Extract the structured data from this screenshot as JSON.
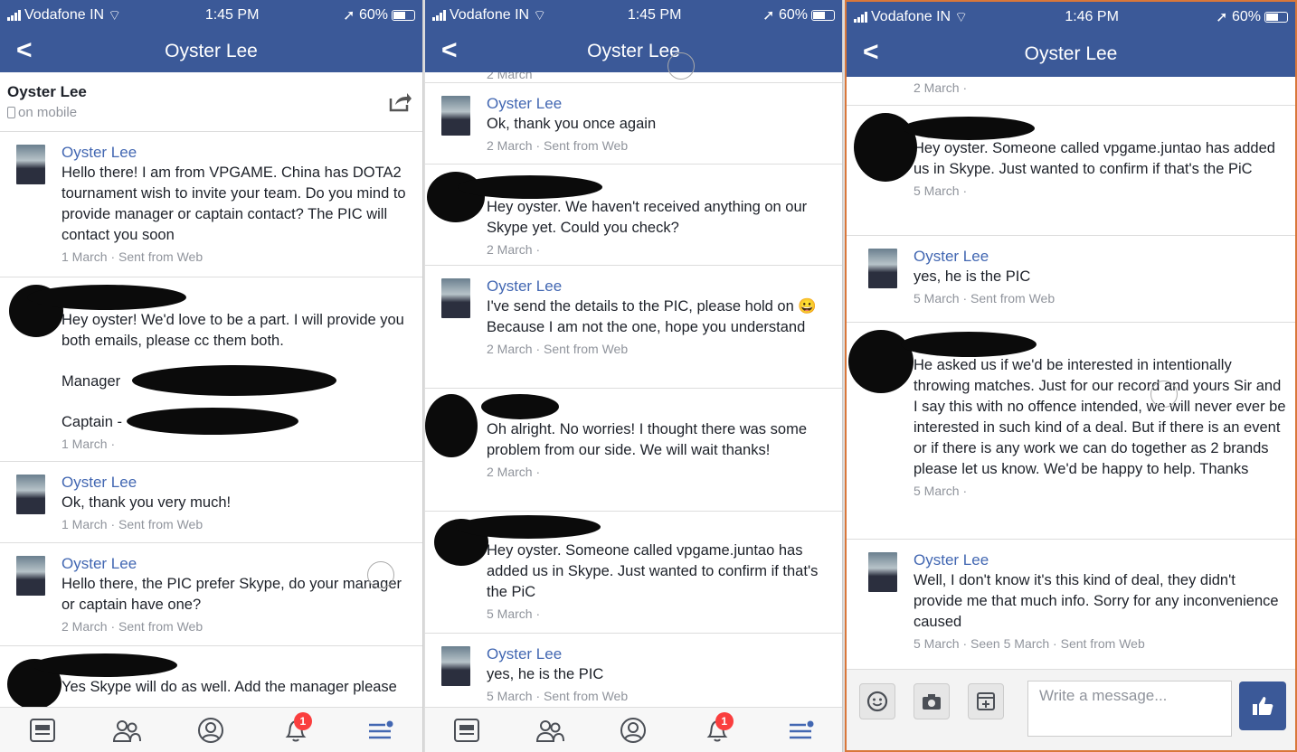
{
  "statusbar": {
    "carrier": "Vodafone IN",
    "battery": "60%",
    "times": [
      "1:45 PM",
      "1:45 PM",
      "1:46 PM"
    ]
  },
  "nav": {
    "title": "Oyster Lee"
  },
  "header": {
    "name": "Oyster Lee",
    "status": "on mobile"
  },
  "composer": {
    "placeholder": "Write a message..."
  },
  "notifications": {
    "badge": "1"
  },
  "panel1": [
    {
      "author": "Oyster Lee",
      "text": "Hello there! I am from VPGAME. China has DOTA2 tournament wish to invite your team. Do you mind to provide manager or captain contact? The PIC will contact you soon",
      "meta": "1 March · Sent from Web"
    },
    {
      "text": "Hey oyster! We'd love to be a part. I will provide you both emails, please cc them both.",
      "manager": "Manager",
      "captain": "Captain -",
      "meta": "1 March ·"
    },
    {
      "author": "Oyster Lee",
      "text": "Ok, thank you very much!",
      "meta": "1 March · Sent from Web"
    },
    {
      "author": "Oyster Lee",
      "text": "Hello there, the PIC prefer Skype, do your manager or captain have one?",
      "meta": "2 March · Sent from Web"
    },
    {
      "text": "Yes Skype will do as well. Add the manager please"
    }
  ],
  "panel2": {
    "top_meta": "2 March",
    "msgs": [
      {
        "author": "Oyster Lee",
        "text": "Ok, thank you once again",
        "meta": "2 March · Sent from Web"
      },
      {
        "text": "Hey oyster. We haven't received anything on our Skype yet. Could you check?",
        "meta": "2 March ·"
      },
      {
        "author": "Oyster Lee",
        "text": "I've send the details to the PIC, please hold on 😀 Because I am not the one, hope you understand",
        "meta": "2 March · Sent from Web"
      },
      {
        "text": "Oh alright. No worries! I thought there was some problem from our side. We will wait thanks!",
        "meta": "2 March ·"
      },
      {
        "text": "Hey oyster. Someone called vpgame.juntao has added us in Skype. Just wanted to confirm if that's the PiC",
        "meta": "5 March ·"
      },
      {
        "author": "Oyster Lee",
        "text": "yes, he is the PIC",
        "meta": "5 March · Sent from Web"
      }
    ]
  },
  "panel3": {
    "top_meta": "2 March ·",
    "msgs": [
      {
        "text": "Hey oyster. Someone called vpgame.juntao has added us in Skype. Just wanted to confirm if that's the PiC",
        "meta": "5 March ·"
      },
      {
        "author": "Oyster Lee",
        "text": "yes, he is the PIC",
        "meta": "5 March · Sent from Web"
      },
      {
        "text": "He asked us if we'd be interested in intentionally throwing matches. Just for our record and yours Sir and I say this with no offence intended, we will never ever be interested in such kind of a deal. But if there is an event or if there is any work we can do together as 2 brands please let us know. We'd be happy to help. Thanks",
        "meta": "5 March ·"
      },
      {
        "author": "Oyster Lee",
        "text": "Well, I don't know it's this kind of deal, they didn't provide me that much info. Sorry for any inconvenience caused",
        "meta": "5 March · Seen 5 March · Sent from Web"
      }
    ]
  }
}
